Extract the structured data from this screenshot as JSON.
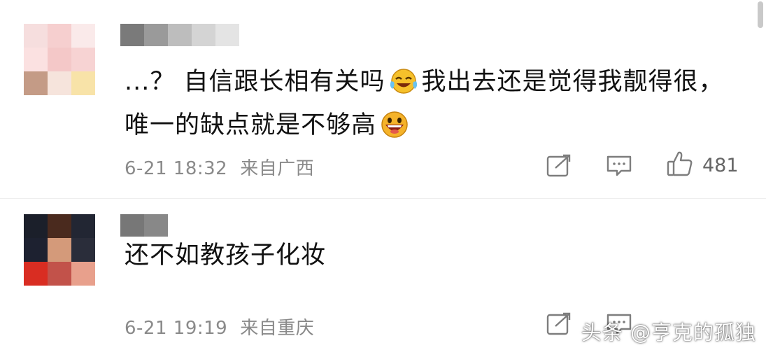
{
  "comments": [
    {
      "avatar_colors": [
        "#f6dede",
        "#f6cfcf",
        "#faeaea",
        "#fbe1e1",
        "#f4c8c8",
        "#f7d3d3",
        "#c49b86",
        "#f6e4dc",
        "#f8e3a8"
      ],
      "name_blur_colors": [
        "#7a7a7a",
        "#9a9a9a",
        "#bdbdbd",
        "#d4d4d4",
        "#e4e4e4"
      ],
      "text_part1": "...？ 自信跟长相有关吗",
      "emoji1": "crying-laughing-emoji",
      "text_part2": "我出去还是觉得我靓得很，唯一的缺点就是不够高",
      "emoji2": "grinning-emoji",
      "date": "6-21 18:32",
      "location": "来自广西",
      "like_count": "481"
    },
    {
      "avatar_colors": [
        "#1b1f2a",
        "#4a2a1e",
        "#222633",
        "#1d2130",
        "#d49a7a",
        "#2a2d3a",
        "#d92d22",
        "#c2524a",
        "#e8a08c"
      ],
      "name_blur_colors": [
        "#777777",
        "#888888"
      ],
      "text": "还不如教孩子化妆",
      "date": "6-21 19:19",
      "location": "来自重庆"
    }
  ],
  "icons": {
    "share": "share-icon",
    "reply": "comment-icon",
    "like": "thumbs-up-icon"
  },
  "watermark": "头条 @亨克的孤独"
}
